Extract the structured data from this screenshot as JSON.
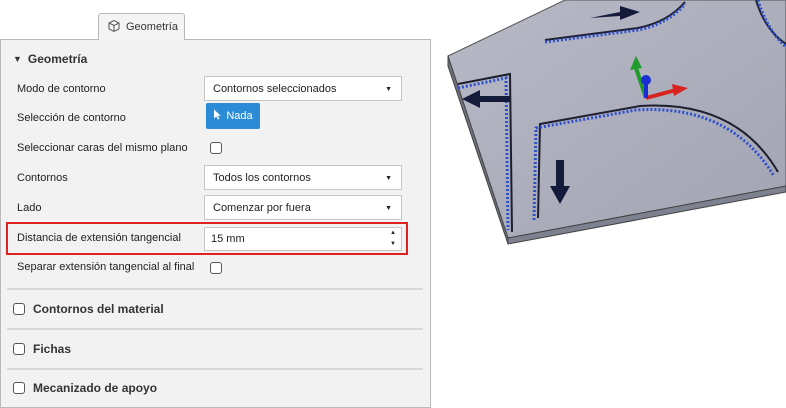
{
  "tab": {
    "label": "Geometría",
    "icon": "cube-icon"
  },
  "section": {
    "title": "Geometría",
    "toggle_icon": "triangle-down-icon"
  },
  "fields": {
    "modo_contorno": {
      "label": "Modo de contorno",
      "value": "Contornos seleccionados"
    },
    "seleccion_contorno": {
      "label": "Selección de contorno",
      "button_label": "Nada"
    },
    "seleccionar_caras": {
      "label": "Seleccionar caras del mismo plano",
      "checked": false
    },
    "contornos": {
      "label": "Contornos",
      "value": "Todos los contornos"
    },
    "lado": {
      "label": "Lado",
      "value": "Comenzar por fuera"
    },
    "distancia": {
      "label": "Distancia de extensión tangencial",
      "value": "15 mm"
    },
    "separar": {
      "label": "Separar extensión tangencial al final",
      "checked": false
    }
  },
  "groups": [
    {
      "label": "Contornos del material",
      "checked": false
    },
    {
      "label": "Fichas",
      "checked": false
    },
    {
      "label": "Mecanizado de apoyo",
      "checked": false
    }
  ],
  "colors": {
    "accent": "#2b8bd6",
    "highlight": "#dd2222",
    "plate": "#a9abb9",
    "path": "#2c4fd0",
    "arrow": "#141a3a"
  }
}
